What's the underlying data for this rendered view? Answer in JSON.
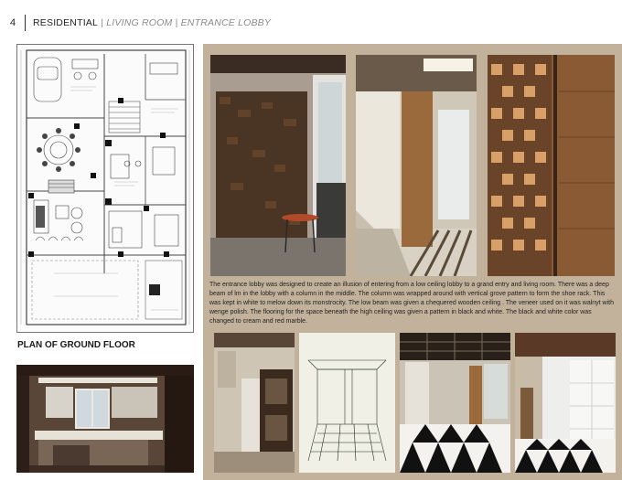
{
  "header": {
    "page_number": "4",
    "section": "RESIDENTIAL",
    "separator": " | ",
    "subsection": "LIVING ROOM | ENTRANCE LOBBY"
  },
  "plan": {
    "caption": "PLAN OF GROUND FLOOR"
  },
  "description": "The entrance lobby was designed to create an illusion of entering from a low ceiling lobby to a grand entry and living room. There was a deep beam of lm in the lobby with a column in the middle. The column was wrapped around with vertical grove pattern to form the shoe rack. This was kept in white to melow down its monstrocity. The low beam was given a chequered wooden ceiling . The veneer used on it was walnyt with wenge polish. The flooring for the space beneath the high ceiling was given a pattern in black and white. The black and white color was changed to cream and red marble.",
  "colors": {
    "panel_bg": "#c3b29b",
    "header_main": "#222222",
    "header_sub": "#8a8a8a"
  }
}
